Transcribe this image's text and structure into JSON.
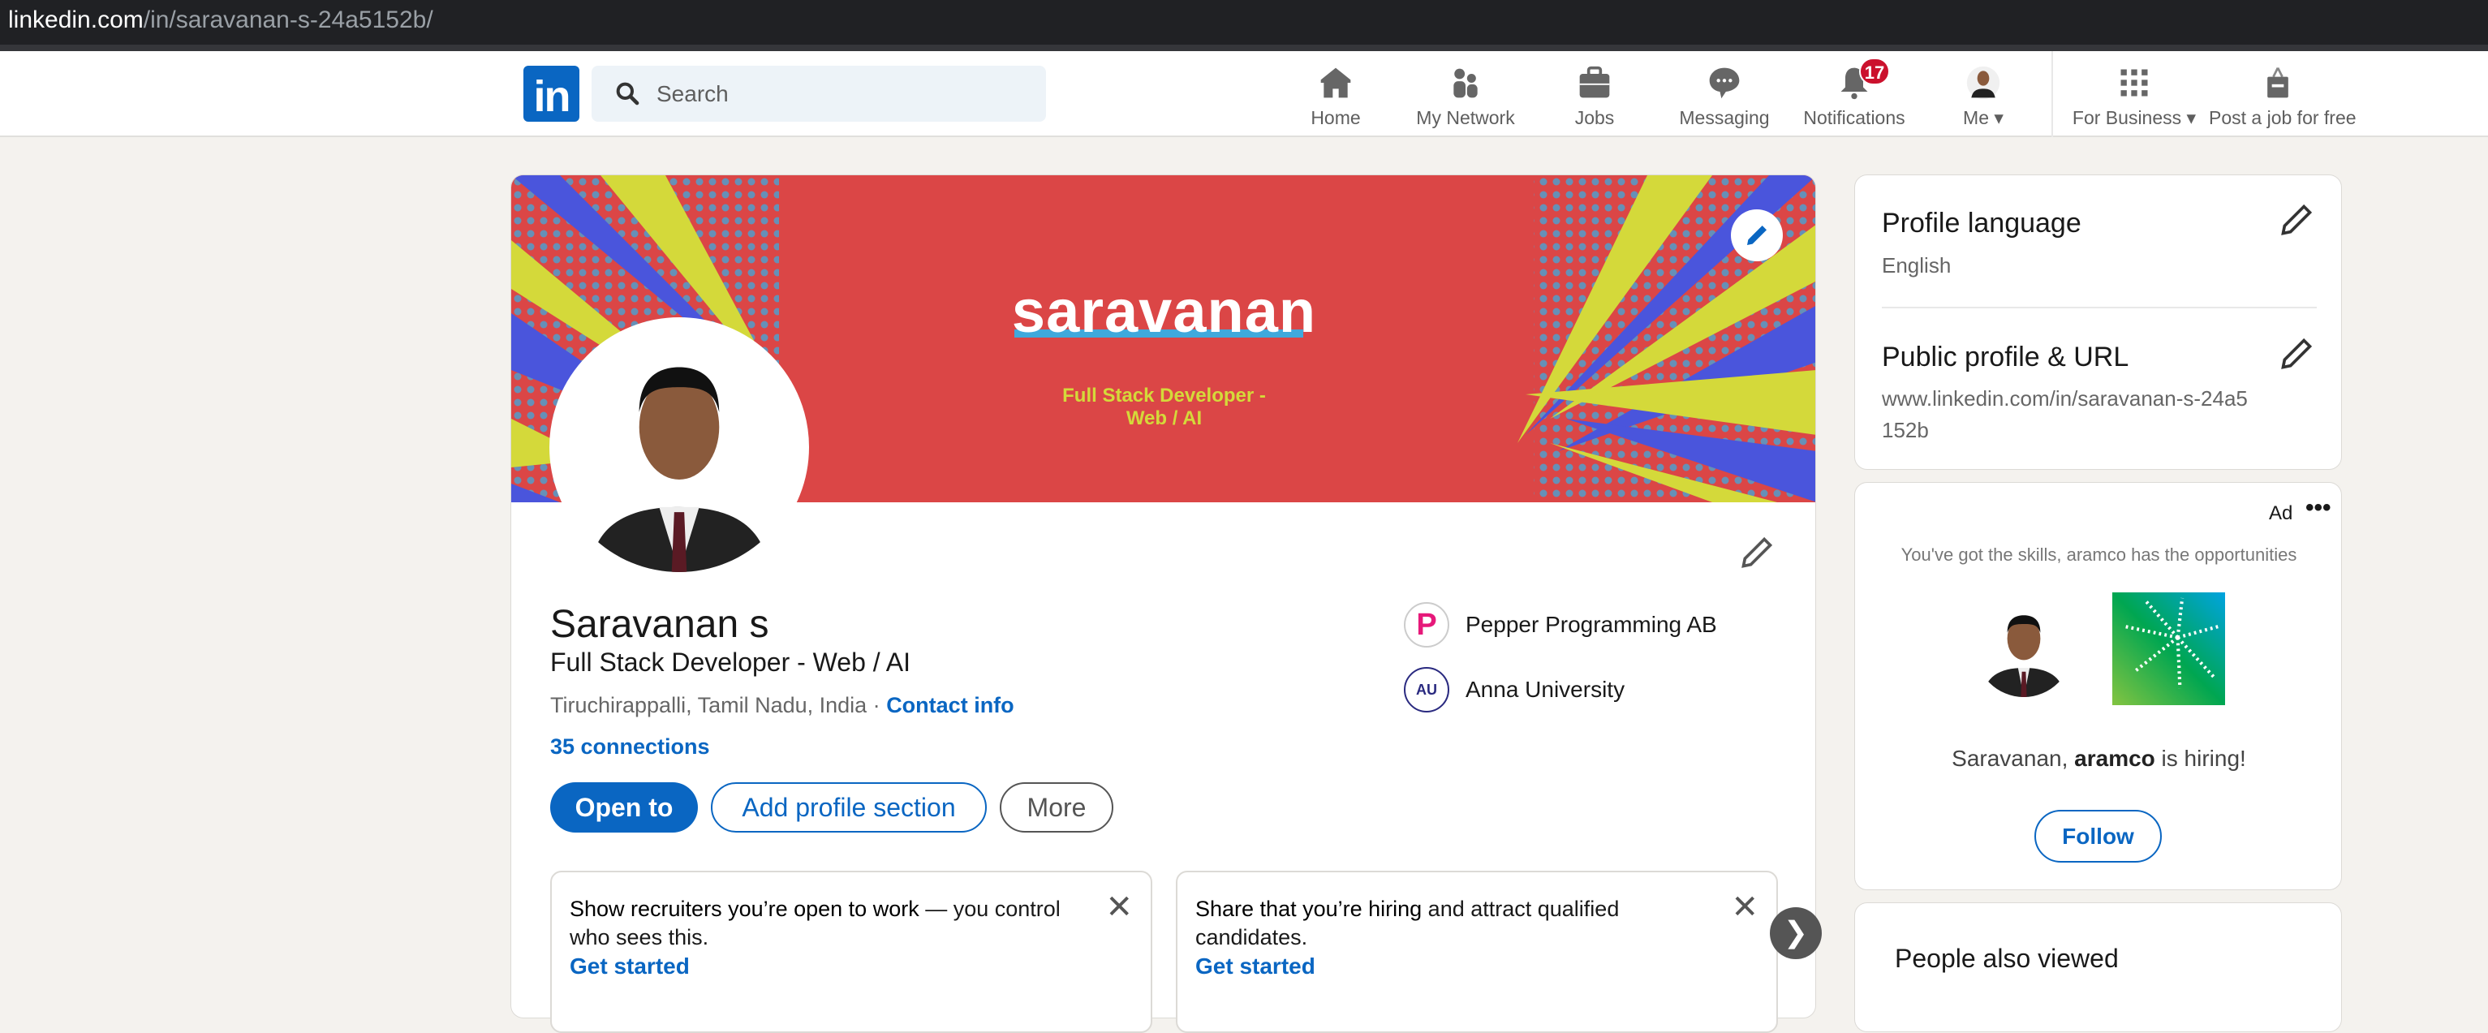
{
  "browser": {
    "url_domain": "linkedin.com",
    "url_path": "/in/saravanan-s-24a5152b/"
  },
  "nav": {
    "logo": "in",
    "search_placeholder": "Search",
    "items": [
      {
        "label": "Home",
        "icon": "home-icon"
      },
      {
        "label": "My Network",
        "icon": "network-icon"
      },
      {
        "label": "Jobs",
        "icon": "briefcase-icon"
      },
      {
        "label": "Messaging",
        "icon": "chat-icon"
      },
      {
        "label": "Notifications",
        "icon": "bell-icon"
      },
      {
        "label": "Me ▾",
        "icon": "avatar"
      },
      {
        "label": "For Business ▾",
        "icon": "grid-icon"
      },
      {
        "label": "Post a job for free",
        "icon": "job-post-icon"
      }
    ],
    "notification_count": "17"
  },
  "banner": {
    "title": "saravanan",
    "subtitle": "Full Stack Developer -\nWeb / AI",
    "colors": {
      "bg": "#db4646",
      "yellow": "#d4d93a",
      "blue": "#4a55dc",
      "dot": "#3fa9dc"
    }
  },
  "profile": {
    "name": "Saravanan s",
    "headline": "Full Stack Developer - Web / AI",
    "location": "Tiruchirappalli, Tamil Nadu, India · ",
    "contact_info": "Contact info",
    "connections": "35 connections",
    "buttons": {
      "open_to": "Open to",
      "add_section": "Add profile section",
      "more": "More"
    },
    "experience": [
      {
        "name": "Pepper Programming AB",
        "logo": "P"
      },
      {
        "name": "Anna University",
        "logo": "AU"
      }
    ]
  },
  "suggestions": [
    {
      "bold": "Show recruiters you’re open to work",
      "rest": " — you control who sees this.",
      "cta": "Get started"
    },
    {
      "bold": "Share that you’re hiring",
      "rest": " and attract qualified candidates.",
      "cta": "Get started"
    }
  ],
  "sidebar": {
    "profile_language": {
      "title": "Profile language",
      "value": "English"
    },
    "public_profile": {
      "title": "Public profile & URL",
      "value": "www.linkedin.com/in/saravanan-s-24a5152b"
    },
    "ad": {
      "label": "Ad",
      "tagline": "You've got the skills, aramco has the opportunities",
      "hiring_pre": "Saravanan, ",
      "hiring_company": "aramco",
      "hiring_post": " is hiring!",
      "follow": "Follow"
    },
    "people_also_viewed": "People also viewed"
  },
  "colors": {
    "accent": "#0a66c2",
    "badge": "#cb112d"
  }
}
